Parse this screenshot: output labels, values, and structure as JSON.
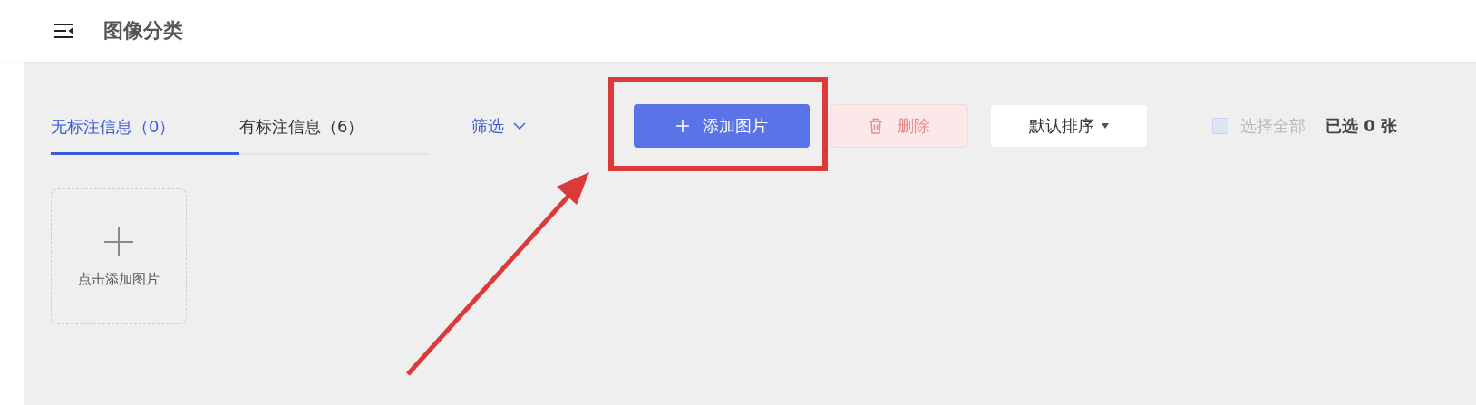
{
  "header": {
    "title": "图像分类"
  },
  "tabs": [
    {
      "label": "无标注信息（0）",
      "selected": true
    },
    {
      "label": "有标注信息（6）",
      "selected": false
    }
  ],
  "filter": {
    "label": "筛选"
  },
  "toolbar": {
    "add_button": "添加图片",
    "delete_button": {
      "label": "删除",
      "disabled": true
    },
    "sort_dropdown": "默认排序",
    "select_all": {
      "label": "选择全部",
      "checked": false,
      "disabled": true
    },
    "selected_count": "已选 0 张"
  },
  "upload_card": {
    "label": "点击添加图片"
  }
}
